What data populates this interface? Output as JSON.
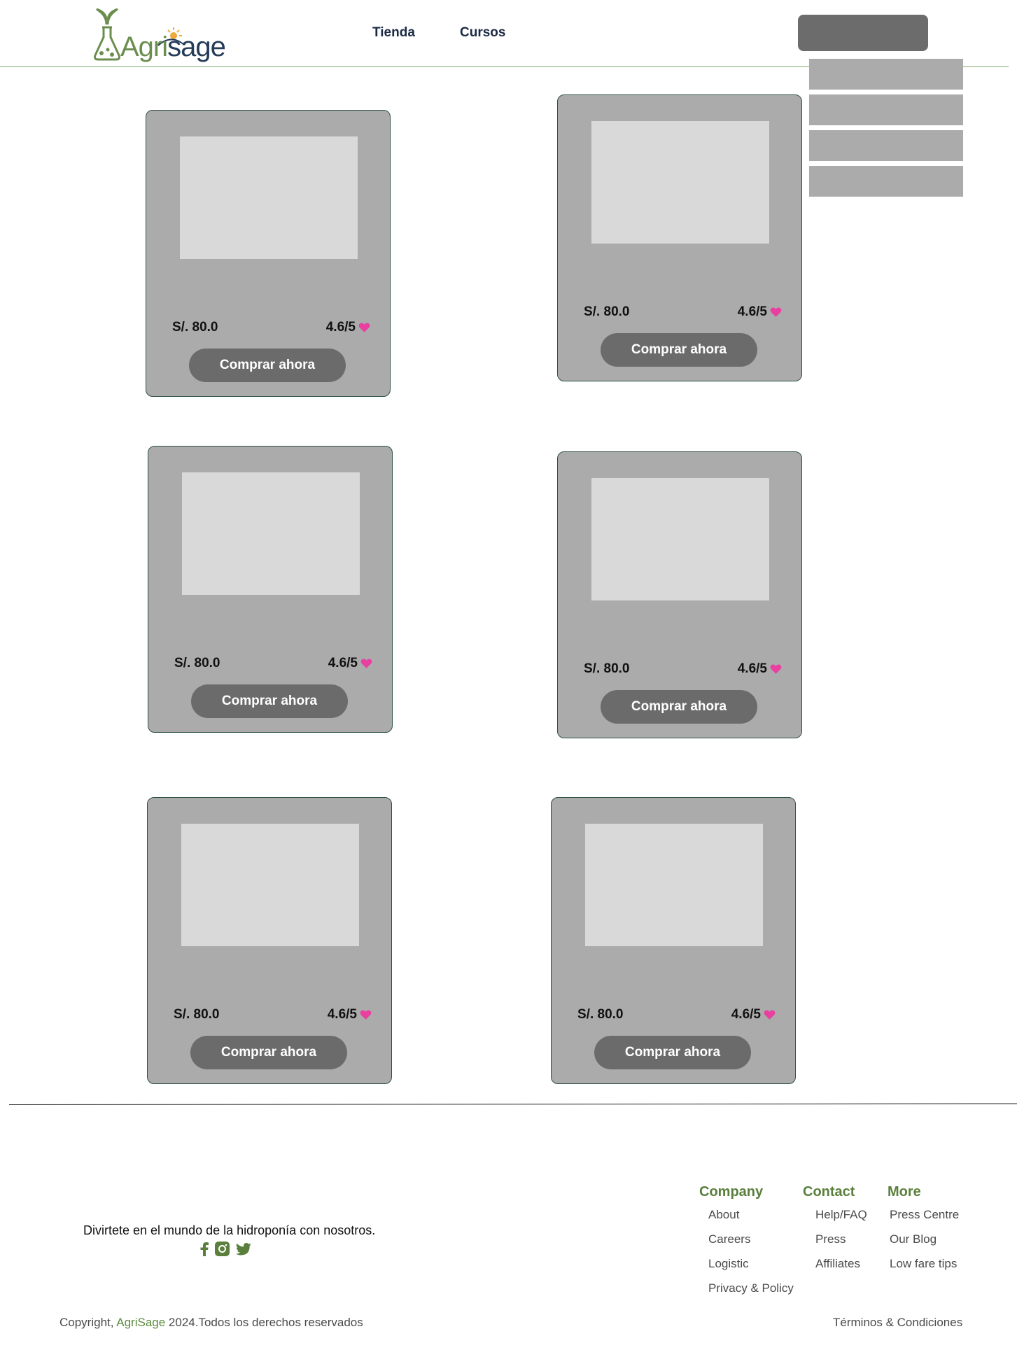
{
  "header": {
    "brand": {
      "part1": "Agri",
      "part2": "sage"
    },
    "nav": [
      {
        "label": "Tienda"
      },
      {
        "label": "Cursos"
      }
    ]
  },
  "cards": [
    {
      "price": "S/. 80.0",
      "rating": "4.6/5",
      "button": "Comprar ahora"
    },
    {
      "price": "S/. 80.0",
      "rating": "4.6/5",
      "button": "Comprar ahora"
    },
    {
      "price": "S/. 80.0",
      "rating": "4.6/5",
      "button": "Comprar ahora"
    },
    {
      "price": "S/. 80.0",
      "rating": "4.6/5",
      "button": "Comprar ahora"
    },
    {
      "price": "S/. 80.0",
      "rating": "4.6/5",
      "button": "Comprar ahora"
    },
    {
      "price": "S/. 80.0",
      "rating": "4.6/5",
      "button": "Comprar ahora"
    }
  ],
  "footer": {
    "tagline": "Divirtete en el mundo de la hidroponía con nosotros.",
    "social": [
      "facebook-icon",
      "instagram-icon",
      "twitter-icon"
    ],
    "columns": [
      {
        "title": "Company",
        "links": [
          "About",
          "Careers",
          "Logistic",
          "Privacy & Policy"
        ]
      },
      {
        "title": "Contact",
        "links": [
          "Help/FAQ",
          "Press",
          "Affiliates"
        ]
      },
      {
        "title": "More",
        "links": [
          "Press Centre",
          "Our Blog",
          "Low fare tips"
        ]
      }
    ],
    "copyright_prefix": "Copyright, ",
    "copyright_brand": "AgriSage",
    "copyright_suffix": " 2024.Todos los derechos reservados",
    "terms": "Términos & Condiciones"
  },
  "colors": {
    "brand_green": "#6b8e4e",
    "heart": "#e83fa0",
    "card_bg": "#ababab"
  }
}
